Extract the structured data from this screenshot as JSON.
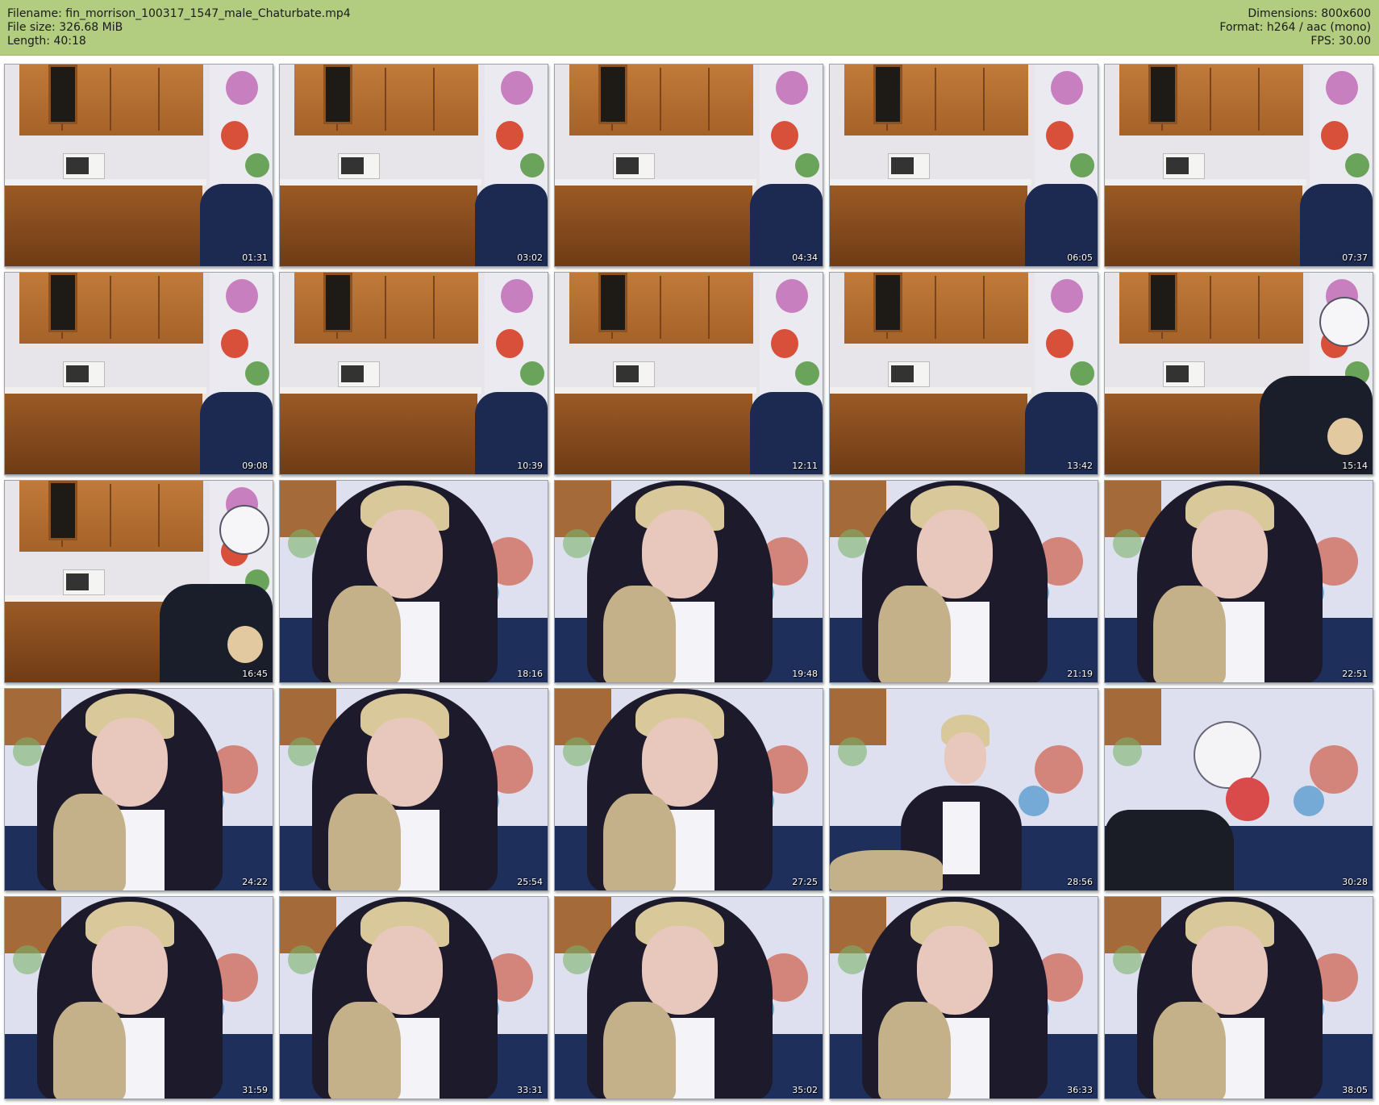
{
  "header": {
    "filename": "Filename: fin_morrison_100317_1547_male_Chaturbate.mp4",
    "filesize": "File size: 326.68 MiB",
    "length": "Length: 40:18",
    "dimensions": "Dimensions: 800x600",
    "format": "Format: h264 / aac (mono)",
    "fps": "FPS: 30.00"
  },
  "thumbnails": [
    {
      "time": "01:31",
      "scene": "kitchen"
    },
    {
      "time": "03:02",
      "scene": "kitchen"
    },
    {
      "time": "04:34",
      "scene": "kitchen"
    },
    {
      "time": "06:05",
      "scene": "kitchen"
    },
    {
      "time": "07:37",
      "scene": "kitchen"
    },
    {
      "time": "09:08",
      "scene": "kitchen"
    },
    {
      "time": "10:39",
      "scene": "kitchen"
    },
    {
      "time": "12:11",
      "scene": "kitchen"
    },
    {
      "time": "13:42",
      "scene": "kitchen"
    },
    {
      "time": "15:14",
      "scene": "kitchen-person"
    },
    {
      "time": "16:45",
      "scene": "kitchen-person"
    },
    {
      "time": "18:16",
      "scene": "person"
    },
    {
      "time": "19:48",
      "scene": "person"
    },
    {
      "time": "21:19",
      "scene": "person"
    },
    {
      "time": "22:51",
      "scene": "person"
    },
    {
      "time": "24:22",
      "scene": "person"
    },
    {
      "time": "25:54",
      "scene": "person"
    },
    {
      "time": "27:25",
      "scene": "person"
    },
    {
      "time": "28:56",
      "scene": "person-distant"
    },
    {
      "time": "30:28",
      "scene": "empty-couch"
    },
    {
      "time": "31:59",
      "scene": "person"
    },
    {
      "time": "33:31",
      "scene": "person"
    },
    {
      "time": "35:02",
      "scene": "person"
    },
    {
      "time": "36:33",
      "scene": "person"
    },
    {
      "time": "38:05",
      "scene": "person"
    }
  ]
}
